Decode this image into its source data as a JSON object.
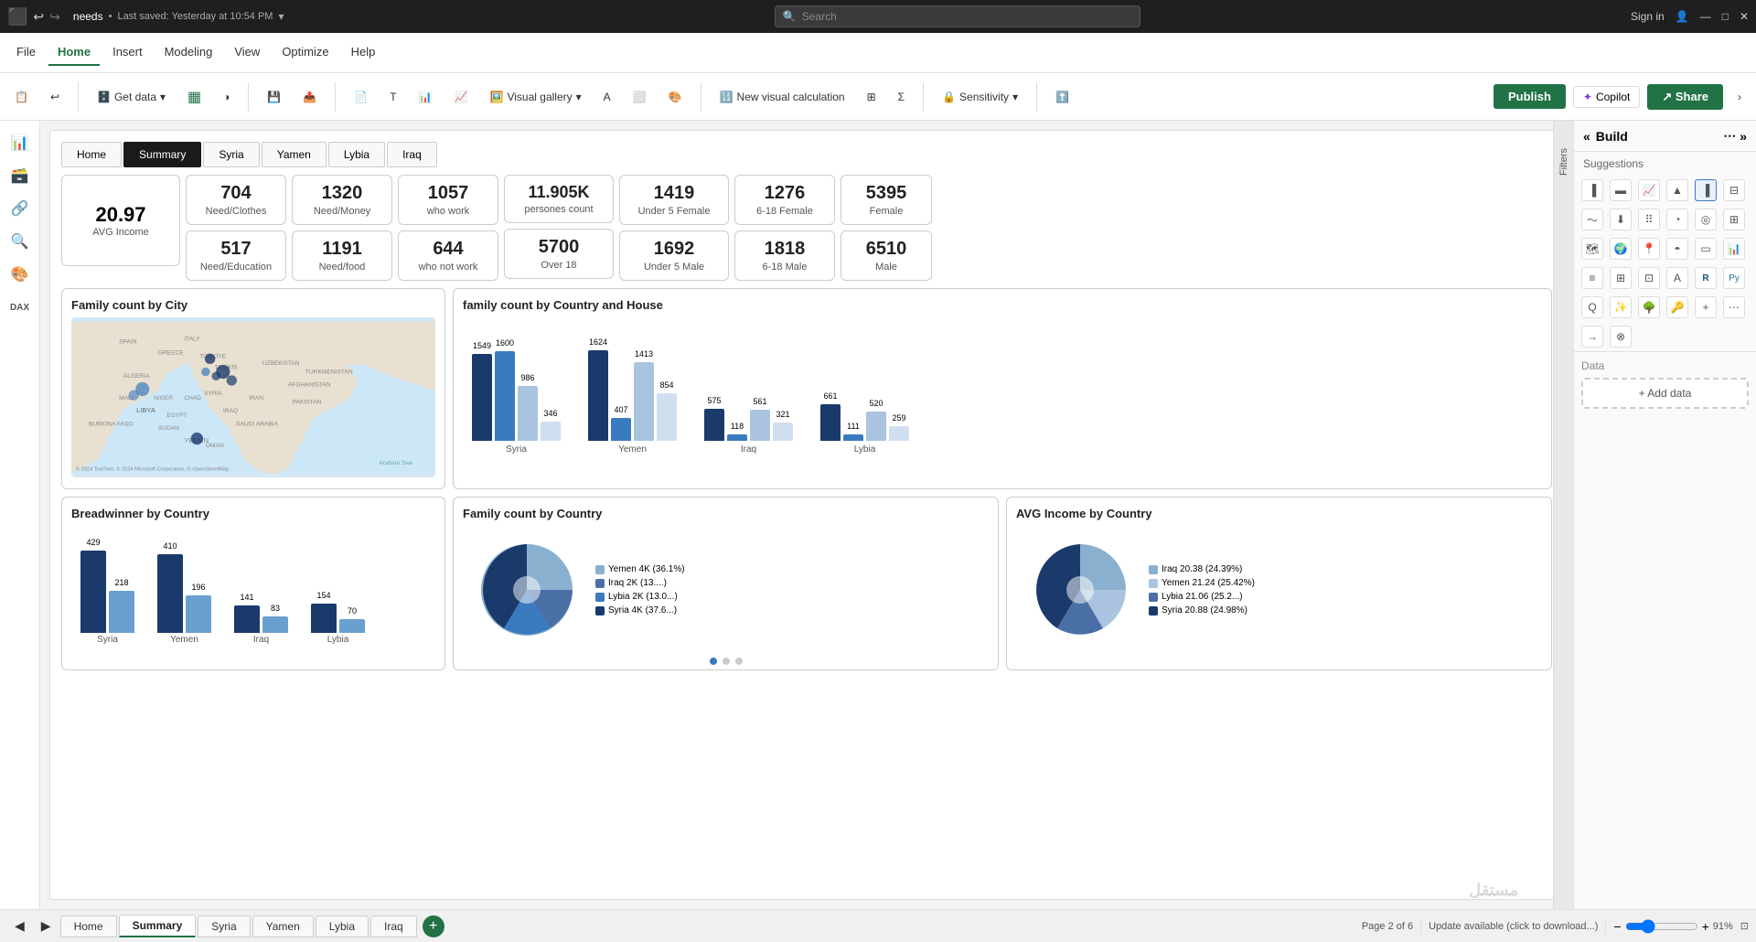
{
  "titleBar": {
    "appIcon": "■",
    "undoIcon": "↩",
    "redoIcon": "↪",
    "filename": "needs",
    "savedText": "Last saved: Yesterday at 10:54 PM",
    "dropdownIcon": "▾",
    "searchPlaceholder": "Search",
    "searchIcon": "🔍",
    "signInText": "Sign in",
    "userIcon": "👤",
    "minimizeIcon": "—",
    "maximizeIcon": "□",
    "closeIcon": "✕"
  },
  "ribbon": {
    "tabs": [
      "File",
      "Home",
      "Insert",
      "Modeling",
      "View",
      "Optimize",
      "Help"
    ],
    "activeTab": "Home"
  },
  "toolbar": {
    "getDataLabel": "Get data",
    "visualGalleryLabel": "Visual gallery",
    "newVisualCalcLabel": "New visual calculation",
    "sensitivityLabel": "Sensitivity",
    "publishLabel": "Publish",
    "shareLabel": "Share",
    "copilotLabel": "Copilot"
  },
  "reportTabs": [
    "Home",
    "Summary",
    "Syria",
    "Yamen",
    "Lybia",
    "Iraq"
  ],
  "activeReportTab": "Summary",
  "dashboard": {
    "kpiAvg": {
      "value": "20.97",
      "label": "AVG Income"
    },
    "kpis": [
      {
        "value": "704",
        "label": "Need/Clothes"
      },
      {
        "value": "1320",
        "label": "Need/Money"
      },
      {
        "value": "517",
        "label": "Need/Education"
      },
      {
        "value": "1191",
        "label": "Need/food"
      },
      {
        "value": "1057",
        "label": "who work"
      },
      {
        "value": "644",
        "label": "who not work"
      },
      {
        "value": "11.905K",
        "label": "persones count"
      },
      {
        "value": "5700",
        "label": "Over 18"
      },
      {
        "value": "1419",
        "label": "Under 5 Female"
      },
      {
        "value": "1692",
        "label": "Under 5 Male"
      },
      {
        "value": "1276",
        "label": "6-18 Female"
      },
      {
        "value": "1818",
        "label": "6-18 Male"
      },
      {
        "value": "5395",
        "label": "Female"
      },
      {
        "value": "6510",
        "label": "Male"
      }
    ],
    "familyCountByCity": {
      "title": "Family count by City"
    },
    "familyCountByCountryHouse": {
      "title": "family count by Country and House",
      "groups": [
        {
          "country": "Syria",
          "bars": [
            {
              "value": 1549,
              "color": "#1a3a6b"
            },
            {
              "value": 1600,
              "color": "#3a7abf"
            },
            {
              "value": 346,
              "color": "#aac4e0"
            },
            {
              "value": 986,
              "color": "#8ab0d0"
            }
          ]
        },
        {
          "country": "Yemen",
          "bars": [
            {
              "value": 1624,
              "color": "#1a3a6b"
            },
            {
              "value": 407,
              "color": "#3a7abf"
            },
            {
              "value": 1413,
              "color": "#aac4e0"
            },
            {
              "value": 854,
              "color": "#8ab0d0"
            }
          ]
        },
        {
          "country": "Iraq",
          "bars": [
            {
              "value": 575,
              "color": "#1a3a6b"
            },
            {
              "value": 118,
              "color": "#3a7abf"
            },
            {
              "value": 561,
              "color": "#aac4e0"
            },
            {
              "value": 321,
              "color": "#8ab0d0"
            }
          ]
        },
        {
          "country": "Lybia",
          "bars": [
            {
              "value": 661,
              "color": "#1a3a6b"
            },
            {
              "value": 111,
              "color": "#3a7abf"
            },
            {
              "value": 520,
              "color": "#aac4e0"
            },
            {
              "value": 259,
              "color": "#8ab0d0"
            }
          ]
        }
      ]
    },
    "breadwinnerByCountry": {
      "title": "Breadwinner by Country",
      "groups": [
        {
          "country": "Syria",
          "bars": [
            {
              "value": 429,
              "color": "#1a3a6b"
            },
            {
              "value": 218,
              "color": "#6aa0d0"
            }
          ]
        },
        {
          "country": "Yemen",
          "bars": [
            {
              "value": 410,
              "color": "#1a3a6b"
            },
            {
              "value": 196,
              "color": "#6aa0d0"
            }
          ]
        },
        {
          "country": "Iraq",
          "bars": [
            {
              "value": 141,
              "color": "#1a3a6b"
            },
            {
              "value": 83,
              "color": "#6aa0d0"
            }
          ]
        },
        {
          "country": "Lybia",
          "bars": [
            {
              "value": 154,
              "color": "#1a3a6b"
            },
            {
              "value": 70,
              "color": "#6aa0d0"
            }
          ]
        }
      ]
    },
    "familyCountByCountry": {
      "title": "Family count by Country",
      "slices": [
        {
          "label": "Yemen 4K (36.1%)",
          "color": "#8ab0d0",
          "percent": 36.1
        },
        {
          "label": "Iraq 2K (13....)",
          "color": "#4a6fa5",
          "percent": 13
        },
        {
          "label": "Lybia 2K (13.0...)",
          "color": "#3a7abf",
          "percent": 13
        },
        {
          "label": "Syria 4K (37.6...)",
          "color": "#1a3a6b",
          "percent": 37.6
        }
      ]
    },
    "avgIncomeByCountry": {
      "title": "AVG Income by Country",
      "slices": [
        {
          "label": "Iraq 20.38 (24.39%)",
          "color": "#8ab0d0",
          "percent": 24.39
        },
        {
          "label": "Yemen 21.24 (25.42%)",
          "color": "#aac4e0",
          "percent": 25.42
        },
        {
          "label": "Lybia 21.06 (25.2...)",
          "color": "#4a6fa5",
          "percent": 25.2
        },
        {
          "label": "Syria 20.88 (24.98%)",
          "color": "#1a3a6b",
          "percent": 24.98
        }
      ]
    }
  },
  "buildPanel": {
    "title": "Build",
    "tabs": [
      "Suggestions",
      "Filters"
    ],
    "activeTab": "Suggestions",
    "suggestionsTitle": "Suggestions",
    "dataTitle": "Data",
    "addDataLabel": "+ Add data"
  },
  "bottomTabs": {
    "tabs": [
      "Home",
      "Summary",
      "Syria",
      "Yamen",
      "Lybia",
      "Iraq"
    ],
    "activeTab": "Summary"
  },
  "statusBar": {
    "pageInfo": "Page 2 of 6",
    "zoomLevel": "91%",
    "updateText": "Update available (click to download...)"
  }
}
